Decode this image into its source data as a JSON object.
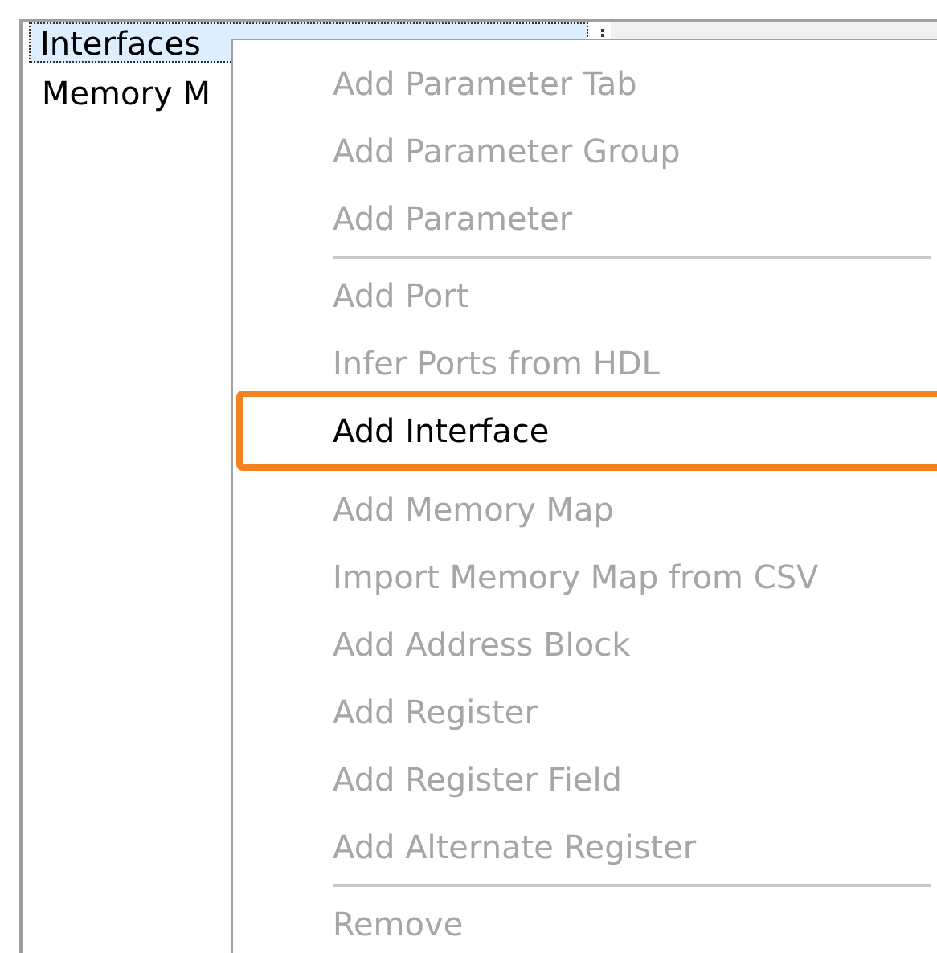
{
  "tree": {
    "items": [
      {
        "label": "Interfaces",
        "selected": true
      },
      {
        "label": "Memory M",
        "selected": false
      }
    ]
  },
  "context_menu": {
    "items": [
      {
        "kind": "item",
        "label": "Add Parameter Tab",
        "disabled": true,
        "highlighted": false
      },
      {
        "kind": "item",
        "label": "Add Parameter Group",
        "disabled": true,
        "highlighted": false
      },
      {
        "kind": "item",
        "label": "Add Parameter",
        "disabled": true,
        "highlighted": false
      },
      {
        "kind": "separator"
      },
      {
        "kind": "item",
        "label": "Add Port",
        "disabled": true,
        "highlighted": false
      },
      {
        "kind": "item",
        "label": "Infer Ports from HDL",
        "disabled": true,
        "highlighted": false
      },
      {
        "kind": "item",
        "label": "Add Interface",
        "disabled": false,
        "highlighted": true
      },
      {
        "kind": "item",
        "label": "Add Memory Map",
        "disabled": true,
        "highlighted": false
      },
      {
        "kind": "item",
        "label": "Import Memory Map from CSV",
        "disabled": true,
        "highlighted": false
      },
      {
        "kind": "item",
        "label": "Add Address Block",
        "disabled": true,
        "highlighted": false
      },
      {
        "kind": "item",
        "label": "Add Register",
        "disabled": true,
        "highlighted": false
      },
      {
        "kind": "item",
        "label": "Add Register Field",
        "disabled": true,
        "highlighted": false
      },
      {
        "kind": "item",
        "label": "Add Alternate Register",
        "disabled": true,
        "highlighted": false
      },
      {
        "kind": "separator"
      },
      {
        "kind": "item",
        "label": "Remove",
        "disabled": true,
        "highlighted": false
      }
    ]
  }
}
